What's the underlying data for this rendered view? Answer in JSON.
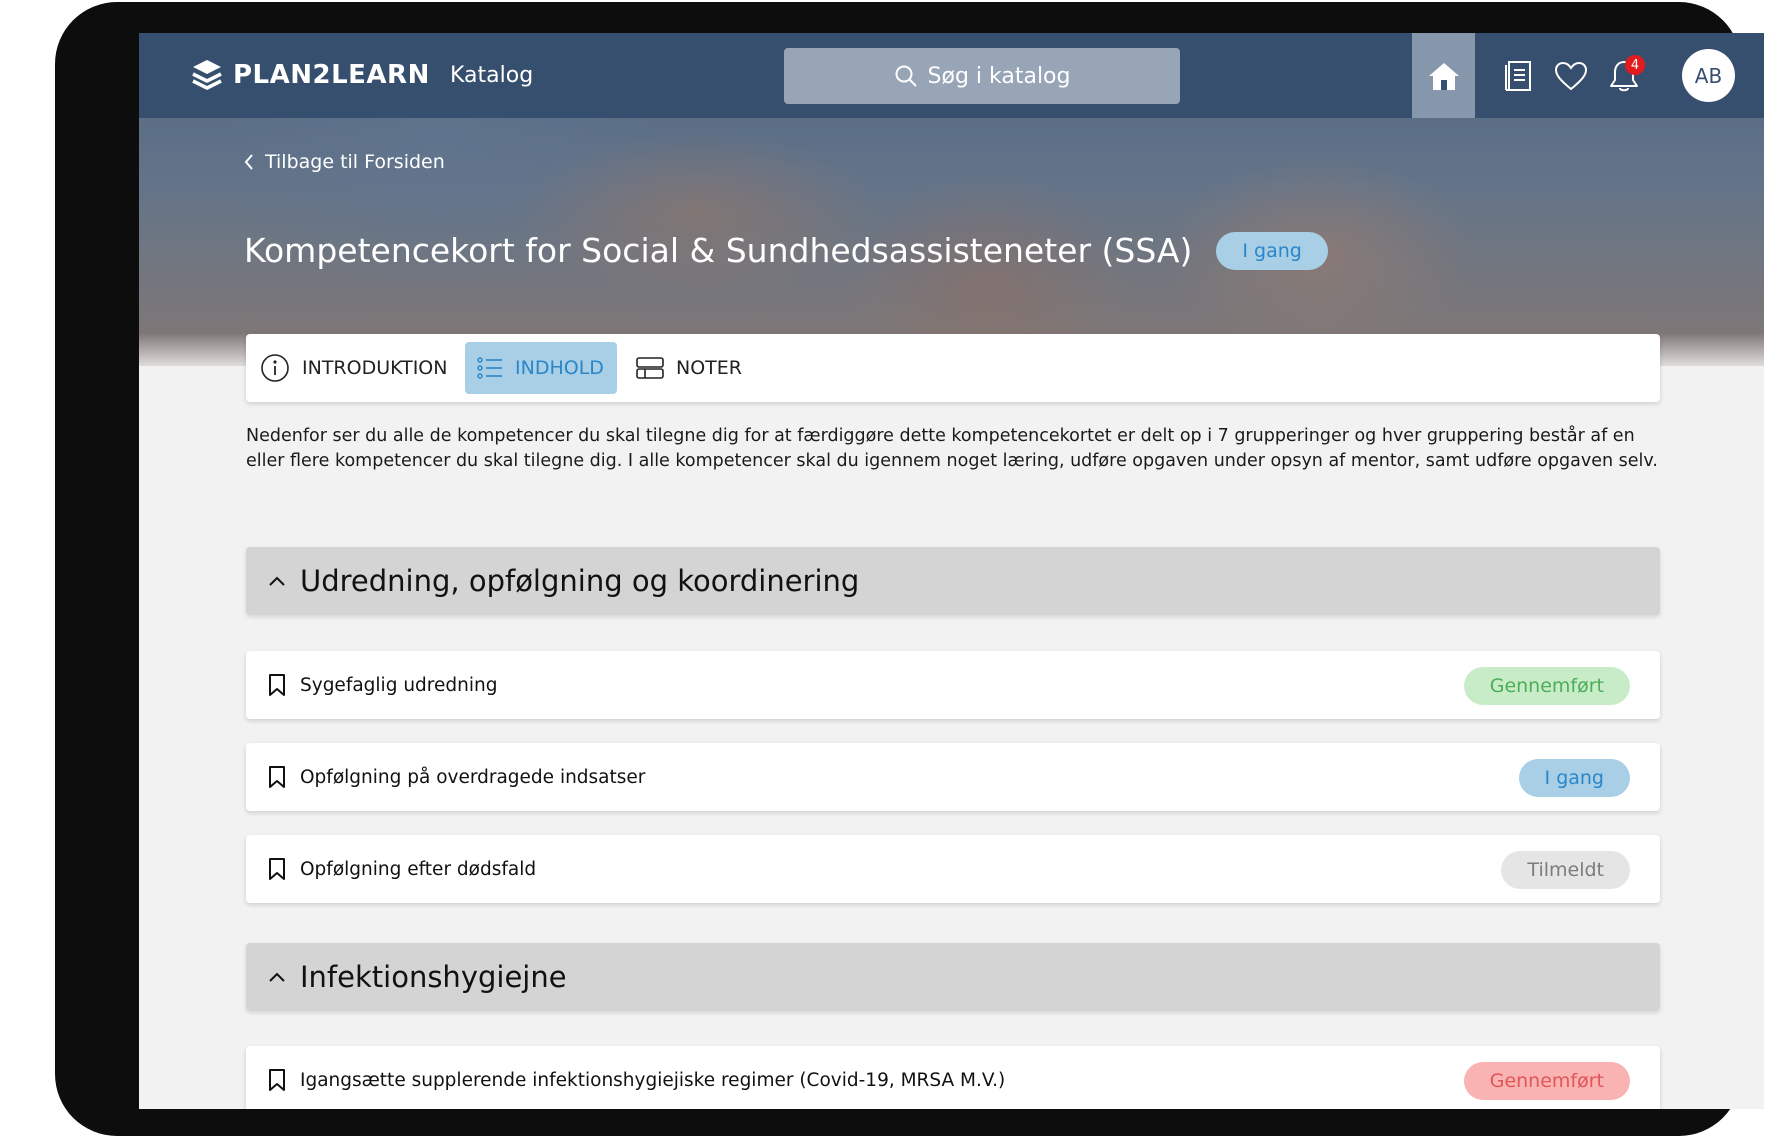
{
  "app": {
    "logo_text": "PLAN2LEARN"
  },
  "nav": {
    "catalog_label": "Katalog",
    "search_placeholder": "Søg i katalog",
    "notifications_count": "4",
    "avatar_initials": "AB",
    "icons": [
      "home-icon",
      "book-icon",
      "heart-icon",
      "bell-icon"
    ]
  },
  "breadcrumb": {
    "back_label": "Tilbage til Forsiden"
  },
  "course": {
    "title": "Kompetencekort for Social & Sundhedsassisteneter (SSA)",
    "status": "I gang"
  },
  "tabs": [
    {
      "label": "INTRODUKTION",
      "icon": "info-icon",
      "active": false
    },
    {
      "label": "INDHOLD",
      "icon": "list-icon",
      "active": true
    },
    {
      "label": "NOTER",
      "icon": "notes-icon",
      "active": false
    }
  ],
  "intro_text": "Nedenfor ser du alle de kompetencer du skal tilegne dig for at færdiggøre dette kompetencekortet er delt op i 7 grupperinger og hver gruppering består af en eller flere kompetencer du skal tilegne dig. I alle kompetencer skal du igennem noget læring, udføre opgaven under opsyn af mentor, samt udføre opgaven selv.",
  "groups": [
    {
      "title": "Udredning, opfølgning og koordinering",
      "items": [
        {
          "label": "Sygefaglig udredning",
          "status": "Gennemført",
          "status_color": "#4cae57"
        },
        {
          "label": "Opfølgning på overdragede indsatser",
          "status": "I gang",
          "status_color": "#2a86c9"
        },
        {
          "label": "Opfølgning efter dødsfald",
          "status": "Tilmeldt",
          "status_color": "#7c7c7c"
        }
      ]
    },
    {
      "title": "Infektionshygiejne",
      "items": [
        {
          "label": "Igangsætte supplerende infektionshygiejiske regimer (Covid-19, MRSA M.V.)",
          "status": "Gennemført",
          "status_color": "#e05757"
        }
      ]
    }
  ],
  "colors": {
    "nav_bg": "#374f6e",
    "accent_blue": "#2a86c9",
    "active_tab_bg": "#a8cfe6"
  }
}
